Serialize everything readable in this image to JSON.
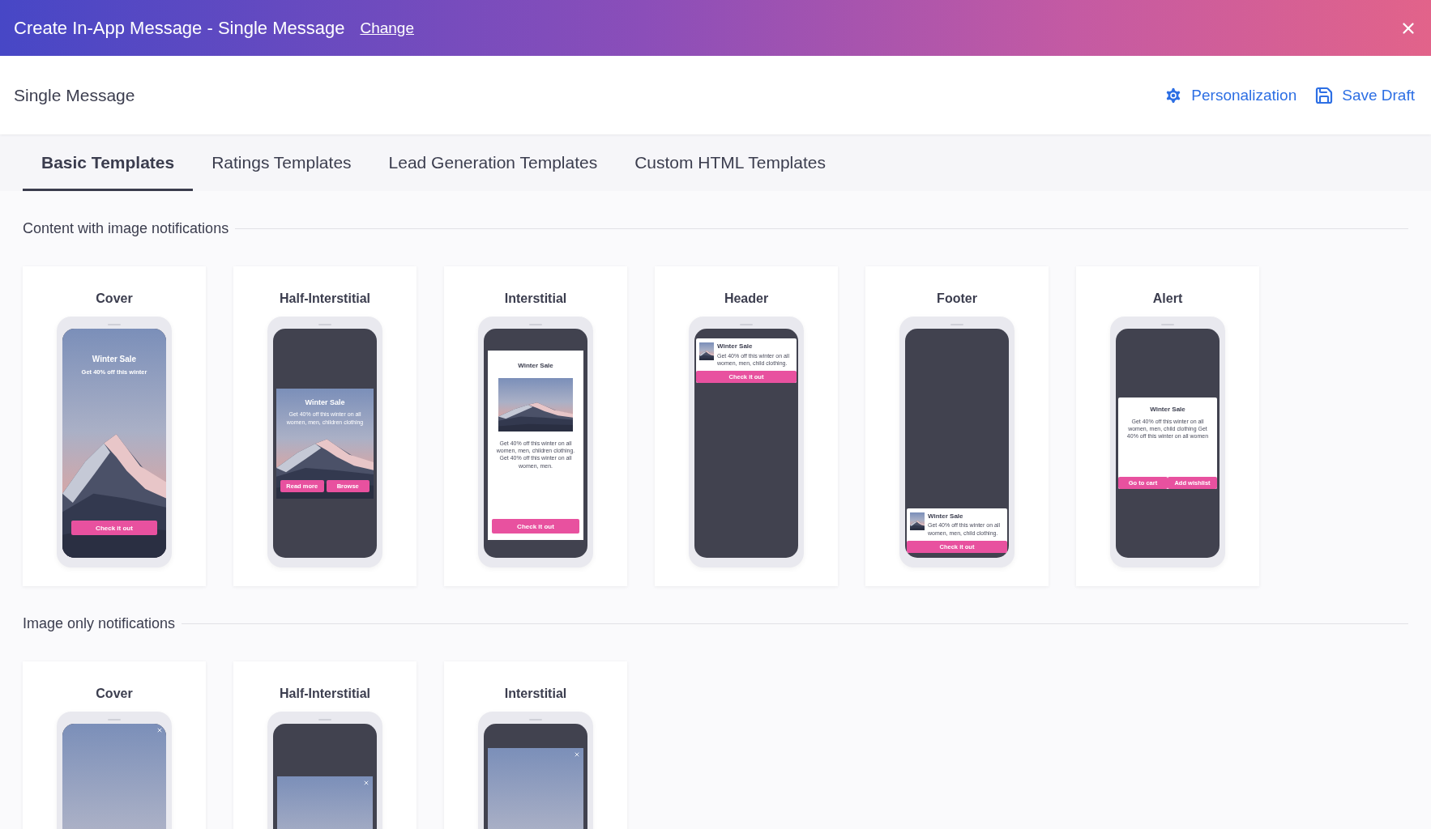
{
  "header": {
    "title": "Create In-App Message - Single Message",
    "link": "Change"
  },
  "toolbar": {
    "title": "Single Message",
    "actions": [
      {
        "label": "Personalization",
        "kind": "gear"
      },
      {
        "label": "Save Draft",
        "kind": "save"
      }
    ]
  },
  "tabs": [
    {
      "label": "Basic Templates",
      "selected": true
    },
    {
      "label": "Ratings Templates",
      "selected": false
    },
    {
      "label": "Lead Generation Templates",
      "selected": false
    },
    {
      "label": "Custom HTML Templates",
      "selected": false
    }
  ],
  "sections": [
    {
      "title": "Content with image notifications",
      "templates": [
        {
          "name": "Cover",
          "kind": "cover",
          "title": "Winter Sale",
          "text": "Get 40% off this winter",
          "buttons": [
            "Check it out"
          ]
        },
        {
          "name": "Half-Interstitial",
          "kind": "half",
          "title": "Winter Sale",
          "text": "Get 40% off this winter on all women, men, children clothing",
          "buttons": [
            "Read more",
            "Browse"
          ]
        },
        {
          "name": "Interstitial",
          "kind": "interstitial",
          "title": "Winter Sale",
          "text": "Get 40% off this winter on all women, men, children clothing. Get 40% off this winter on all women, men.",
          "buttons": [
            "Check it out"
          ]
        },
        {
          "name": "Header",
          "kind": "header",
          "title": "Winter Sale",
          "text": "Get 40% off this winter on all women, men, child clothing.",
          "buttons": [
            "Check it out"
          ]
        },
        {
          "name": "Footer",
          "kind": "footer",
          "title": "Winter Sale",
          "text": "Get 40% off this winter on all women, men, child clothing.",
          "buttons": [
            "Check it out"
          ]
        },
        {
          "name": "Alert",
          "kind": "alert",
          "title": "Winter Sale",
          "text": "Get 40% off this winter on all women, men, child clothing Get 40% off this winter on all women",
          "buttons": [
            "Go to cart",
            "Add wishlist"
          ]
        }
      ]
    },
    {
      "title": "Image only notifications",
      "templates": [
        {
          "name": "Cover",
          "kind": "image_cover"
        },
        {
          "name": "Half-Interstitial",
          "kind": "image_half"
        },
        {
          "name": "Interstitial",
          "kind": "image_interstitial"
        }
      ]
    }
  ]
}
